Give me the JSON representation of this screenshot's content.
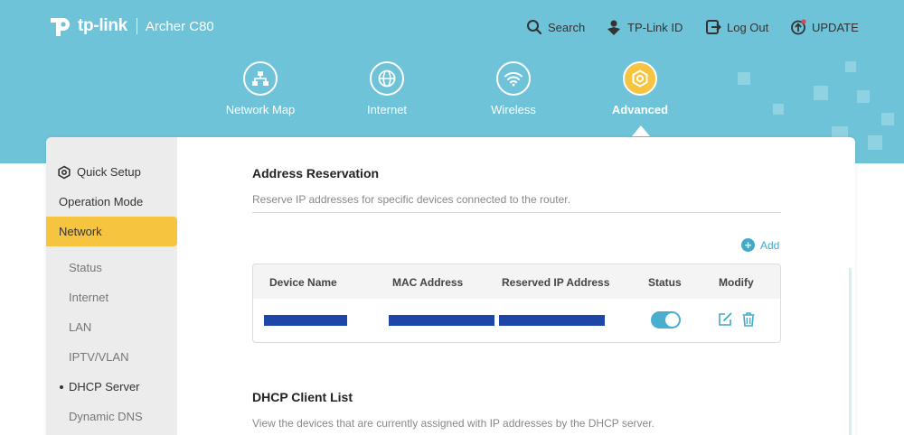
{
  "brand": {
    "name": "tp-link",
    "model": "Archer C80"
  },
  "top_links": [
    {
      "label": "Search",
      "icon": "search-icon"
    },
    {
      "label": "TP-Link ID",
      "icon": "account-icon"
    },
    {
      "label": "Log Out",
      "icon": "logout-icon"
    },
    {
      "label": "UPDATE",
      "icon": "update-icon"
    }
  ],
  "nav": [
    {
      "label": "Network Map",
      "icon": "network-map-icon"
    },
    {
      "label": "Internet",
      "icon": "globe-icon"
    },
    {
      "label": "Wireless",
      "icon": "wifi-icon"
    },
    {
      "label": "Advanced",
      "icon": "gear-icon",
      "active": true
    }
  ],
  "sidebar": {
    "items": [
      {
        "label": "Quick Setup",
        "icon": "gear-icon"
      },
      {
        "label": "Operation Mode"
      },
      {
        "label": "Network",
        "active": true
      },
      {
        "label": "Status"
      },
      {
        "label": "Internet"
      },
      {
        "label": "LAN"
      },
      {
        "label": "IPTV/VLAN"
      },
      {
        "label": "DHCP Server",
        "current": true
      },
      {
        "label": "Dynamic DNS"
      }
    ]
  },
  "reservation": {
    "title": "Address Reservation",
    "description": "Reserve IP addresses for specific devices connected to the router.",
    "add_label": "Add",
    "columns": [
      "Device Name",
      "MAC Address",
      "Reserved IP Address",
      "Status",
      "Modify"
    ],
    "rows": [
      {
        "device_name": "[redacted]",
        "mac": "[redacted]",
        "ip": "[redacted]",
        "status_on": true
      }
    ]
  },
  "client_list": {
    "title": "DHCP Client List",
    "description": "View the devices that are currently assigned with IP addresses by the DHCP server."
  },
  "colors": {
    "header_bg": "#6ec3d8",
    "accent_yellow": "#f6c43e",
    "accent_blue": "#44a9c8",
    "redaction": "#1d46a8",
    "update_dot": "#e0474c"
  }
}
